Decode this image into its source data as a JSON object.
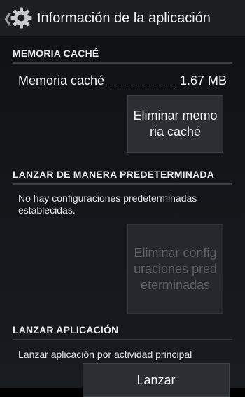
{
  "action_bar": {
    "title": "Información de la aplicación",
    "icon": "settings-gear-icon",
    "up_icon": "chevron-left-icon",
    "up_glyph": "❮"
  },
  "cache_section": {
    "header": "MEMORIA CACHÉ",
    "label": "Memoria caché",
    "value": "1.67 MB",
    "clear_button": "Eliminar memoria caché"
  },
  "defaults_section": {
    "header": "LANZAR DE MANERA PREDETERMINADA",
    "message": "No hay configuraciones predeterminadas establecidas.",
    "clear_button": "Eliminar configuraciones predeterminadas",
    "clear_button_enabled": false
  },
  "launch_section": {
    "header": "LANZAR APLICACIÓN",
    "message": "Lanzar aplicación por actividad principal",
    "launch_button": "Lanzar"
  },
  "colors": {
    "action_bar_bg": "#1d1e20",
    "content_bg": "#14181c",
    "button_bg": "#2b2e32",
    "disabled_text": "#5f6266",
    "divider": "#3a3d41"
  }
}
